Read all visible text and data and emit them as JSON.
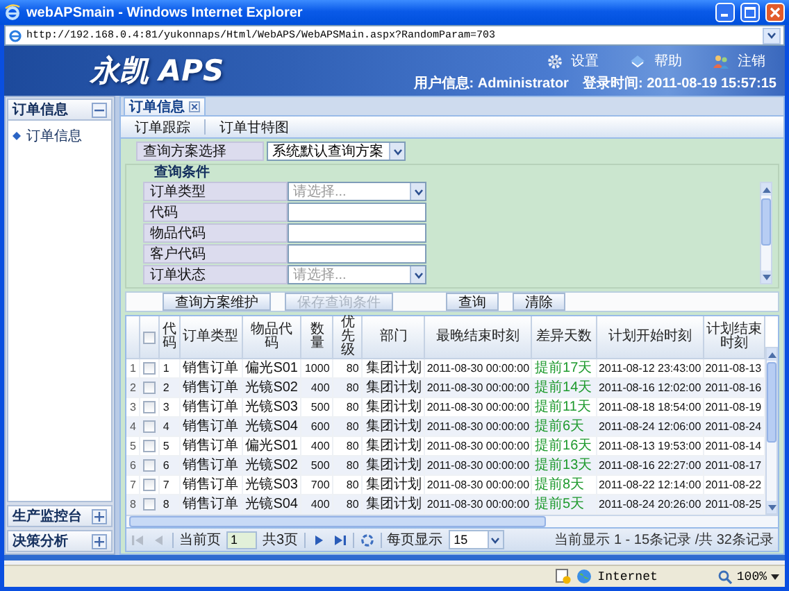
{
  "window": {
    "title": "webAPSmain - Windows Internet Explorer",
    "address": "http://192.168.0.4:81/yukonnaps/Html/WebAPS/WebAPSMain.aspx?RandomParam=703"
  },
  "header": {
    "logo": "永凯 APS",
    "menu": [
      "设置",
      "帮助",
      "注销"
    ],
    "user_label": "用户信息:",
    "user": "Administrator",
    "login_label": "登录时间:",
    "login_time": "2011-08-19 15:57:15"
  },
  "sidebar": {
    "panels": [
      {
        "title": "订单信息",
        "expanded": true,
        "items": [
          "订单信息"
        ]
      },
      {
        "title": "生产监控台",
        "expanded": false
      },
      {
        "title": "决策分析",
        "expanded": false
      }
    ]
  },
  "tabs": [
    {
      "label": "订单信息",
      "selected": true
    }
  ],
  "toolbar": [
    "订单跟踪",
    "订单甘特图"
  ],
  "query": {
    "scheme_label": "查询方案选择",
    "scheme_value": "系统默认查询方案",
    "conditions_title": "查询条件",
    "conditions": [
      {
        "label": "订单类型",
        "kind": "select",
        "placeholder": "请选择..."
      },
      {
        "label": "代码",
        "kind": "text"
      },
      {
        "label": "物品代码",
        "kind": "text"
      },
      {
        "label": "客户代码",
        "kind": "text"
      },
      {
        "label": "订单状态",
        "kind": "select",
        "placeholder": "请选择..."
      }
    ],
    "scheme_buttons": [
      {
        "label": "查询方案维护",
        "disabled": false
      },
      {
        "label": "保存查询条件",
        "disabled": true
      }
    ],
    "action_buttons": [
      {
        "label": "查询",
        "disabled": false
      },
      {
        "label": "清除",
        "disabled": false
      }
    ]
  },
  "table": {
    "all_checked": false,
    "columns": [
      {
        "label": "代码",
        "kind": "id"
      },
      {
        "label": "订单类型",
        "kind": "text"
      },
      {
        "label": "物品代码",
        "kind": "text"
      },
      {
        "label": "数量",
        "kind": "number"
      },
      {
        "label": "优先级",
        "kind": "number"
      },
      {
        "label": "部门",
        "kind": "text"
      },
      {
        "label": "最晚结束时刻",
        "kind": "datetime"
      },
      {
        "label": "差异天数",
        "kind": "status"
      },
      {
        "label": "计划开始时刻",
        "kind": "datetime"
      },
      {
        "label": "计划结束时刻",
        "kind": "datetime"
      }
    ],
    "rows": [
      {
        "num": "1",
        "checked": false,
        "cells": [
          "1",
          "销售订单",
          "偏光S01",
          "1000",
          "80",
          "集团计划",
          "2011-08-30 00:00:00",
          "提前17天",
          "2011-08-12 23:43:00",
          "2011-08-13"
        ]
      },
      {
        "num": "2",
        "checked": false,
        "cells": [
          "2",
          "销售订单",
          "光镜S02",
          "400",
          "80",
          "集团计划",
          "2011-08-30 00:00:00",
          "提前14天",
          "2011-08-16 12:02:00",
          "2011-08-16"
        ]
      },
      {
        "num": "3",
        "checked": false,
        "cells": [
          "3",
          "销售订单",
          "光镜S03",
          "500",
          "80",
          "集团计划",
          "2011-08-30 00:00:00",
          "提前11天",
          "2011-08-18 18:54:00",
          "2011-08-19"
        ]
      },
      {
        "num": "4",
        "checked": false,
        "cells": [
          "4",
          "销售订单",
          "光镜S04",
          "600",
          "80",
          "集团计划",
          "2011-08-30 00:00:00",
          "提前6天",
          "2011-08-24 12:06:00",
          "2011-08-24"
        ]
      },
      {
        "num": "5",
        "checked": false,
        "cells": [
          "5",
          "销售订单",
          "偏光S01",
          "400",
          "80",
          "集团计划",
          "2011-08-30 00:00:00",
          "提前16天",
          "2011-08-13 19:53:00",
          "2011-08-14"
        ]
      },
      {
        "num": "6",
        "checked": false,
        "cells": [
          "6",
          "销售订单",
          "光镜S02",
          "500",
          "80",
          "集团计划",
          "2011-08-30 00:00:00",
          "提前13天",
          "2011-08-16 22:27:00",
          "2011-08-17"
        ]
      },
      {
        "num": "7",
        "checked": false,
        "cells": [
          "7",
          "销售订单",
          "光镜S03",
          "700",
          "80",
          "集团计划",
          "2011-08-30 00:00:00",
          "提前8天",
          "2011-08-22 12:14:00",
          "2011-08-22"
        ]
      },
      {
        "num": "8",
        "checked": false,
        "cells": [
          "8",
          "销售订单",
          "光镜S04",
          "400",
          "80",
          "集团计划",
          "2011-08-30 00:00:00",
          "提前5天",
          "2011-08-24 20:26:00",
          "2011-08-25"
        ]
      }
    ]
  },
  "pager": {
    "nav_back": [
      {
        "kind": "first",
        "disabled": true
      },
      {
        "kind": "prev",
        "disabled": true
      }
    ],
    "page_label": "当前页",
    "page": "1",
    "total": "共3页",
    "nav_forward": [
      {
        "kind": "next",
        "disabled": false
      },
      {
        "kind": "last",
        "disabled": false
      }
    ],
    "per_page_label": "每页显示",
    "per_page": "15",
    "summary": "当前显示 1 - 15条记录 /共 32条记录"
  },
  "status_bar": {
    "zone": "Internet",
    "zoom": "100%"
  }
}
